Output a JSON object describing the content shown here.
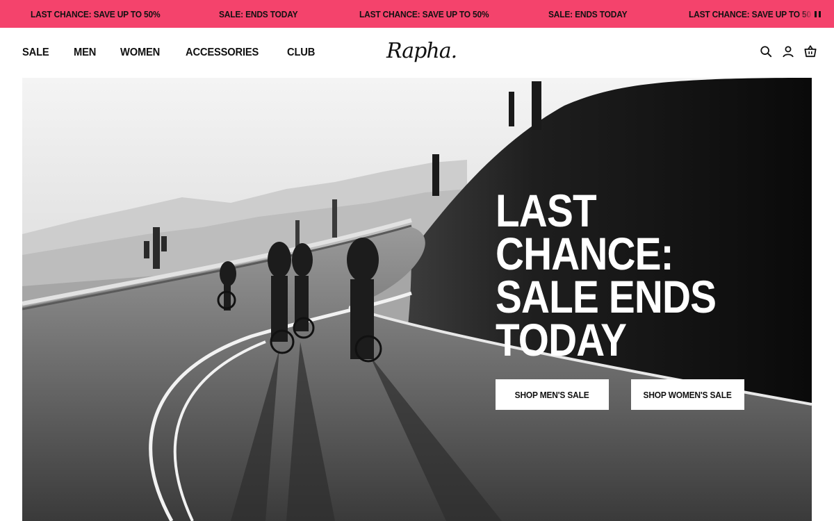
{
  "promo_bar": {
    "messages": [
      "LAST CHANCE: SAVE UP TO 50%",
      "SALE: ENDS TODAY",
      "LAST CHANCE: SAVE UP TO 50%",
      "SALE: ENDS TODAY",
      "LAST CHANCE: SAVE UP TO 50"
    ],
    "background": "#f4436c"
  },
  "header": {
    "nav": [
      "SALE",
      "MEN",
      "WOMEN",
      "ACCESSORIES",
      "CLUB"
    ],
    "logo": "Rapha.",
    "icons": [
      "search-icon",
      "account-icon",
      "basket-icon"
    ]
  },
  "hero": {
    "headline": [
      "LAST",
      "CHANCE:",
      "SALE ENDS",
      "TODAY"
    ],
    "cta_primary": "SHOP MEN'S SALE",
    "cta_secondary": "SHOP WOMEN'S SALE"
  }
}
